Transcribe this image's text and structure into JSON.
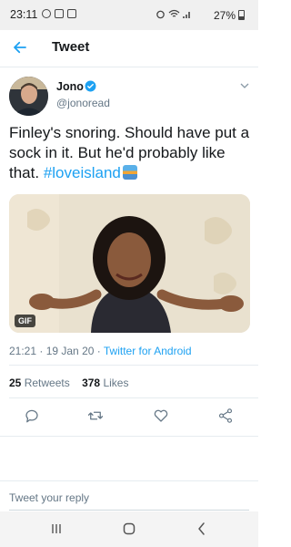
{
  "status_bar": {
    "time": "23:11",
    "battery": "27%"
  },
  "header": {
    "title": "Tweet",
    "back_icon": "arrow-left-icon"
  },
  "tweet": {
    "author": {
      "name": "Jono",
      "handle": "@jonoread",
      "verified": true
    },
    "text_parts": {
      "line": "Finley's snoring. Should have put a sock in it. But he'd probably like that. ",
      "hashtag": "#loveisland"
    },
    "media": {
      "badge": "GIF"
    },
    "meta": {
      "time": "21:21",
      "separator": " · ",
      "date": "19 Jan 20",
      "source": "Twitter for Android"
    },
    "stats": {
      "retweets_count": "25",
      "retweets_label": "Retweets",
      "likes_count": "378",
      "likes_label": "Likes"
    },
    "actions": [
      "reply-icon",
      "retweet-icon",
      "like-icon",
      "share-icon"
    ]
  },
  "reply": {
    "placeholder": "Tweet your reply"
  },
  "colors": {
    "accent": "#1da1f2",
    "secondary_text": "#657786",
    "primary_text": "#14171a",
    "divider": "#e6ecf0"
  }
}
